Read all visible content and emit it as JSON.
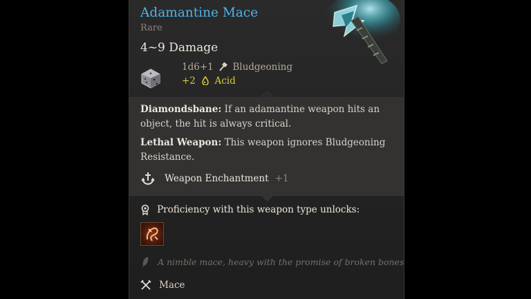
{
  "item": {
    "name": "Adamantine Mace",
    "rarity": "Rare",
    "damage_summary": "4~9 Damage",
    "damage_dice": "1d6+1",
    "damage_type": "Bludgeoning",
    "bonus_amount": "+2",
    "bonus_type": "Acid",
    "colors": {
      "name": "#4fb3e8",
      "bonus": "#d8cc3a",
      "panel_bg": "#333231",
      "tooltip_bg": "#2b2a2a"
    }
  },
  "properties": [
    {
      "title": "Diamondsbane:",
      "text": "If an adamantine weapon hits an object, the hit is always critical."
    },
    {
      "title": "Lethal Weapon:",
      "text": "This weapon ignores Bludgeoning Resistance."
    }
  ],
  "enchantment": {
    "label": "Weapon Enchantment",
    "bonus": "+1",
    "icon": "enchantment-icon"
  },
  "proficiency": {
    "label": "Proficiency with this weapon type unlocks:",
    "icon": "proficiency-icon",
    "action_icon": "weapon-action-icon"
  },
  "flavor": {
    "text": "A nimble mace, heavy with the promise of broken bones.",
    "icon": "quill-icon"
  },
  "weapon_type": {
    "label": "Mace",
    "icon": "crossed-weapons-icon"
  },
  "icons": {
    "die": "d6-die-icon",
    "damage_type": "bludgeoning-icon",
    "bonus_type": "acid-icon",
    "art": "weapon-artwork"
  }
}
